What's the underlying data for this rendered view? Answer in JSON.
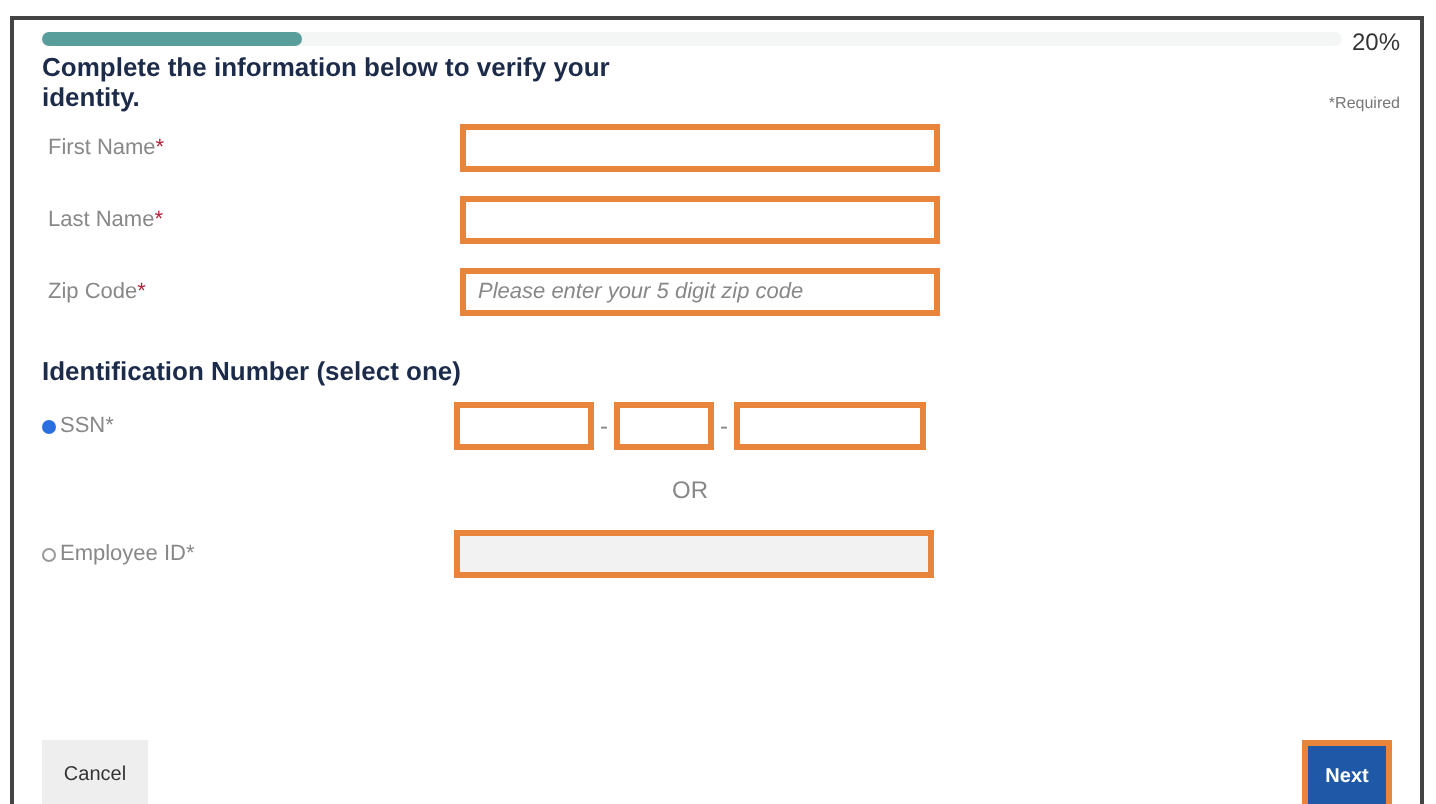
{
  "progress": {
    "level": 0.2,
    "reading": "20%"
  },
  "required_note": "*Required",
  "heading": "Complete the information below to verify your identity.",
  "fields": [
    {
      "label": "First Name",
      "mark": "*"
    },
    {
      "label": "Last Name",
      "mark": "*"
    },
    {
      "label": "Zip Code",
      "mark": "*",
      "placeholder": "Please enter your 5 digit zip code"
    }
  ],
  "id_heading": "Identification Number (select one)",
  "ssn": {
    "label": "SSN",
    "mark": "*",
    "selected": true,
    "separators": [
      "-",
      "-"
    ]
  },
  "or": "OR",
  "employee_id": {
    "label": "Employee ID",
    "mark": "*",
    "selected": false,
    "disabled": true
  },
  "buttons": {
    "cancel": "Cancel",
    "next": "Next"
  }
}
